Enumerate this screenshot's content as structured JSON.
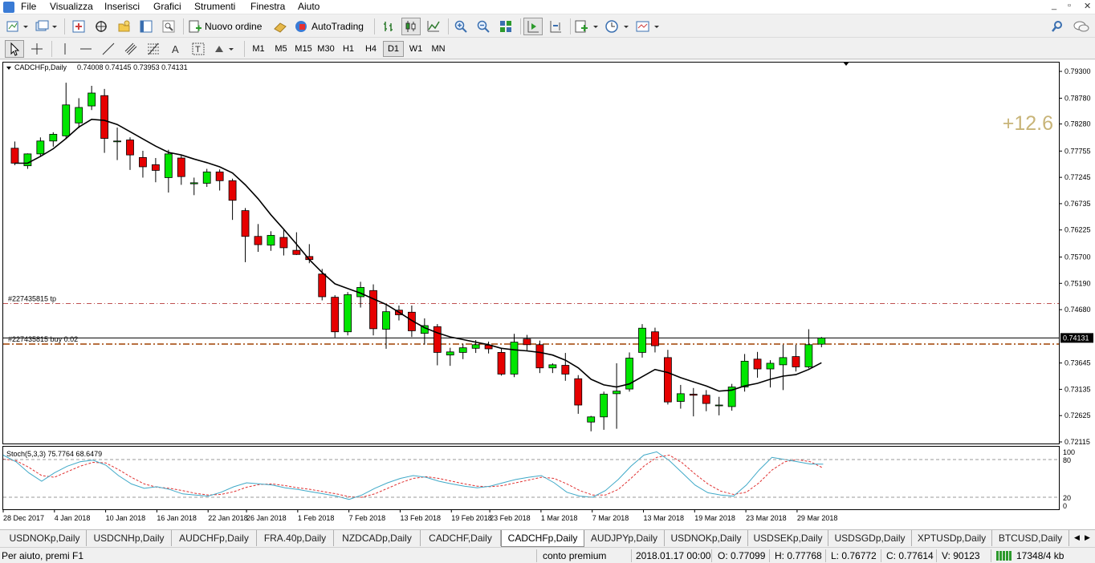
{
  "menu": [
    "File",
    "Visualizza",
    "Inserisci",
    "Grafici",
    "Strumenti",
    "Finestra",
    "Aiuto"
  ],
  "window_controls": [
    "_",
    "▫",
    "✕"
  ],
  "toolbar": {
    "new_order_label": "Nuovo ordine",
    "autotrading_label": "AutoTrading",
    "timeframes": [
      "M1",
      "M5",
      "M15",
      "M30",
      "H1",
      "H4",
      "D1",
      "W1",
      "MN"
    ],
    "active_timeframe": "D1",
    "icons": [
      "new-chart-icon",
      "profiles-icon",
      "market-watch-icon",
      "navigator-icon",
      "data-window-icon",
      "terminal-icon",
      "tester-icon",
      "expert-advisor-icon",
      "bar-chart-icon",
      "candlestick-icon",
      "line-chart-icon",
      "zoom-in-icon",
      "zoom-out-icon",
      "tile-windows-icon",
      "auto-scroll-icon",
      "chart-shift-icon",
      "indicators-icon",
      "periods-icon",
      "templates-icon",
      "search-icon",
      "chat-icon",
      "cursor-icon",
      "crosshair-icon",
      "vertical-line-icon",
      "horizontal-line-icon",
      "trendline-icon",
      "equidistant-channel-icon",
      "fibonacci-icon",
      "text-icon",
      "text-label-icon",
      "arrows-icon"
    ]
  },
  "chart": {
    "symbol_header": "CADCHFp,Daily",
    "ohlc_header": "0.74008 0.74145 0.73953 0.74131",
    "profit_overlay": "+12.6",
    "current_price_label": "0.74131",
    "tp_line_label": "#227435815 tp",
    "order_line_label": "#227435815 buy 0.02",
    "price_ticks": [
      "0.79300",
      "0.78780",
      "0.78280",
      "0.77755",
      "0.77245",
      "0.76735",
      "0.76225",
      "0.75700",
      "0.75190",
      "0.74680",
      "0.74131",
      "0.73645",
      "0.73135",
      "0.72625",
      "0.72115"
    ],
    "date_ticks": [
      "28 Dec 2017",
      "4 Jan 2018",
      "10 Jan 2018",
      "16 Jan 2018",
      "22 Jan 2018",
      "26 Jan 2018",
      "1 Feb 2018",
      "7 Feb 2018",
      "13 Feb 2018",
      "19 Feb 2018",
      "23 Feb 2018",
      "1 Mar 2018",
      "7 Mar 2018",
      "13 Mar 2018",
      "19 Mar 2018",
      "23 Mar 2018",
      "29 Mar 2018"
    ],
    "stoch_label": "Stoch(5,3,3) 75.7764 68.6479",
    "stoch_levels": [
      "100",
      "80",
      "20",
      "0"
    ],
    "colors": {
      "bull": "#00e600",
      "bear": "#e60000",
      "ma": "#000000",
      "stoch_main": "#3fa9c8",
      "stoch_signal": "#e03030",
      "tp_line": "#c05050",
      "order_line": "#a04000",
      "profit": "#c8b478"
    }
  },
  "chart_data": {
    "type": "candlestick",
    "candles": [
      [
        0.7781,
        0.7794,
        0.7748,
        0.7752
      ],
      [
        0.7747,
        0.7771,
        0.7741,
        0.777
      ],
      [
        0.777,
        0.7802,
        0.7766,
        0.7795
      ],
      [
        0.7795,
        0.7812,
        0.7784,
        0.7808
      ],
      [
        0.7805,
        0.7908,
        0.7799,
        0.7865
      ],
      [
        0.783,
        0.7878,
        0.782,
        0.786
      ],
      [
        0.7863,
        0.7902,
        0.7855,
        0.7888
      ],
      [
        0.7883,
        0.7896,
        0.7772,
        0.78
      ],
      [
        0.7795,
        0.7821,
        0.7758,
        0.7795
      ],
      [
        0.7797,
        0.7802,
        0.7739,
        0.7768
      ],
      [
        0.7763,
        0.7776,
        0.7724,
        0.7745
      ],
      [
        0.7749,
        0.7762,
        0.7715,
        0.7738
      ],
      [
        0.7724,
        0.7778,
        0.7695,
        0.777
      ],
      [
        0.7762,
        0.7768,
        0.771,
        0.7726
      ],
      [
        0.7712,
        0.7724,
        0.769,
        0.7714
      ],
      [
        0.7713,
        0.7741,
        0.7706,
        0.7735
      ],
      [
        0.7735,
        0.774,
        0.7699,
        0.7718
      ],
      [
        0.7718,
        0.7722,
        0.7642,
        0.768
      ],
      [
        0.766,
        0.7665,
        0.756,
        0.761
      ],
      [
        0.761,
        0.7634,
        0.758,
        0.7594
      ],
      [
        0.7593,
        0.762,
        0.7582,
        0.7612
      ],
      [
        0.7608,
        0.7624,
        0.7573,
        0.7588
      ],
      [
        0.7583,
        0.7618,
        0.7574,
        0.7575
      ],
      [
        0.7571,
        0.7595,
        0.7558,
        0.7565
      ],
      [
        0.7537,
        0.7547,
        0.7486,
        0.7493
      ],
      [
        0.7492,
        0.7496,
        0.7414,
        0.7425
      ],
      [
        0.7425,
        0.7502,
        0.7418,
        0.7497
      ],
      [
        0.7493,
        0.7522,
        0.7472,
        0.7511
      ],
      [
        0.7505,
        0.7517,
        0.7418,
        0.7431
      ],
      [
        0.743,
        0.7479,
        0.7392,
        0.7464
      ],
      [
        0.7467,
        0.7476,
        0.7447,
        0.7458
      ],
      [
        0.7463,
        0.7476,
        0.7415,
        0.7427
      ],
      [
        0.7422,
        0.7451,
        0.74,
        0.7437
      ],
      [
        0.7435,
        0.744,
        0.736,
        0.7385
      ],
      [
        0.738,
        0.7394,
        0.7359,
        0.7386
      ],
      [
        0.7385,
        0.7402,
        0.7372,
        0.7394
      ],
      [
        0.7393,
        0.7409,
        0.7384,
        0.74
      ],
      [
        0.7399,
        0.7406,
        0.7383,
        0.7392
      ],
      [
        0.7385,
        0.7392,
        0.734,
        0.7343
      ],
      [
        0.7343,
        0.7421,
        0.7337,
        0.7405
      ],
      [
        0.7411,
        0.7419,
        0.7389,
        0.74
      ],
      [
        0.74,
        0.7408,
        0.7345,
        0.7355
      ],
      [
        0.7355,
        0.7364,
        0.7345,
        0.7361
      ],
      [
        0.736,
        0.7384,
        0.733,
        0.7343
      ],
      [
        0.7334,
        0.7341,
        0.7266,
        0.7283
      ],
      [
        0.725,
        0.7262,
        0.7232,
        0.726
      ],
      [
        0.726,
        0.7309,
        0.7235,
        0.7304
      ],
      [
        0.7305,
        0.7364,
        0.7237,
        0.731
      ],
      [
        0.7314,
        0.7385,
        0.7309,
        0.7374
      ],
      [
        0.7385,
        0.744,
        0.7375,
        0.7432
      ],
      [
        0.7425,
        0.7433,
        0.7385,
        0.7398
      ],
      [
        0.7375,
        0.739,
        0.7284,
        0.7289
      ],
      [
        0.729,
        0.7322,
        0.7276,
        0.7305
      ],
      [
        0.7304,
        0.7316,
        0.7261,
        0.7302
      ],
      [
        0.7302,
        0.7312,
        0.7271,
        0.7286
      ],
      [
        0.7282,
        0.7299,
        0.7263,
        0.7283
      ],
      [
        0.728,
        0.7324,
        0.7272,
        0.7318
      ],
      [
        0.7318,
        0.7382,
        0.7309,
        0.7368
      ],
      [
        0.7372,
        0.7386,
        0.7336,
        0.7353
      ],
      [
        0.7353,
        0.737,
        0.7317,
        0.7364
      ],
      [
        0.7361,
        0.74,
        0.7312,
        0.7375
      ],
      [
        0.7377,
        0.74,
        0.7348,
        0.7357
      ],
      [
        0.7357,
        0.743,
        0.7354,
        0.74
      ],
      [
        0.7401,
        0.7415,
        0.7395,
        0.7413
      ]
    ],
    "ma": [
      0.7752,
      0.7752,
      0.7765,
      0.778,
      0.78,
      0.7822,
      0.7837,
      0.7835,
      0.7827,
      0.7813,
      0.7799,
      0.7785,
      0.7773,
      0.7768,
      0.776,
      0.7753,
      0.7745,
      0.7733,
      0.771,
      0.7683,
      0.7652,
      0.7624,
      0.7595,
      0.7565,
      0.754,
      0.7518,
      0.7509,
      0.75,
      0.7489,
      0.7478,
      0.7463,
      0.7447,
      0.7433,
      0.7423,
      0.7415,
      0.741,
      0.7405,
      0.74,
      0.7393,
      0.739,
      0.7388,
      0.7385,
      0.738,
      0.737,
      0.7355,
      0.7333,
      0.7322,
      0.7318,
      0.7324,
      0.7338,
      0.7352,
      0.7346,
      0.7336,
      0.7328,
      0.732,
      0.731,
      0.7312,
      0.732,
      0.7325,
      0.7333,
      0.7339,
      0.7342,
      0.7352,
      0.7365
    ],
    "stoch_main": [
      92,
      80,
      60,
      45,
      60,
      72,
      80,
      83,
      74,
      55,
      40,
      32,
      35,
      30,
      22,
      20,
      18,
      25,
      35,
      42,
      40,
      38,
      33,
      30,
      26,
      22,
      18,
      12,
      20,
      32,
      42,
      50,
      55,
      52,
      45,
      40,
      36,
      33,
      36,
      42,
      48,
      52,
      55,
      42,
      25,
      18,
      16,
      28,
      48,
      72,
      92,
      98,
      82,
      60,
      38,
      24,
      20,
      18,
      38,
      65,
      88,
      84,
      80,
      76,
      75.78
    ],
    "stoch_signal": [
      85,
      82,
      70,
      55,
      52,
      62,
      72,
      79,
      78,
      66,
      52,
      40,
      34,
      32,
      28,
      23,
      20,
      21,
      26,
      34,
      39,
      40,
      37,
      33,
      30,
      26,
      22,
      17,
      16,
      22,
      32,
      42,
      50,
      53,
      50,
      45,
      40,
      36,
      35,
      37,
      42,
      47,
      52,
      50,
      40,
      28,
      20,
      20,
      30,
      50,
      72,
      88,
      92,
      78,
      58,
      40,
      27,
      21,
      25,
      42,
      65,
      80,
      84,
      80,
      68.65
    ],
    "ylim": [
      0.72115,
      0.793
    ],
    "stoch_ylim": [
      0,
      100
    ],
    "tp_price": 0.74797,
    "order_price": 0.74012,
    "current_price": 0.74131
  },
  "tabs": [
    "USDNOKp,Daily",
    "USDCNHp,Daily",
    "AUDCHFp,Daily",
    "FRA.40p,Daily",
    "NZDCADp,Daily",
    "CADCHF,Daily",
    "CADCHFp,Daily",
    "AUDJPYp,Daily",
    "USDNOKp,Daily",
    "USDSEKp,Daily",
    "USDSGDp,Daily",
    "XPTUSDp,Daily",
    "BTCUSD,Daily"
  ],
  "active_tab": "CADCHFp,Daily",
  "status": {
    "help": "Per aiuto, premi F1",
    "profile": "conto premium",
    "datetime": "2018.01.17 00:00",
    "open": "O: 0.77099",
    "high": "H: 0.77768",
    "low": "L: 0.76772",
    "close": "C: 0.77614",
    "volume": "V: 90123",
    "traffic": "17348/4 kb"
  }
}
